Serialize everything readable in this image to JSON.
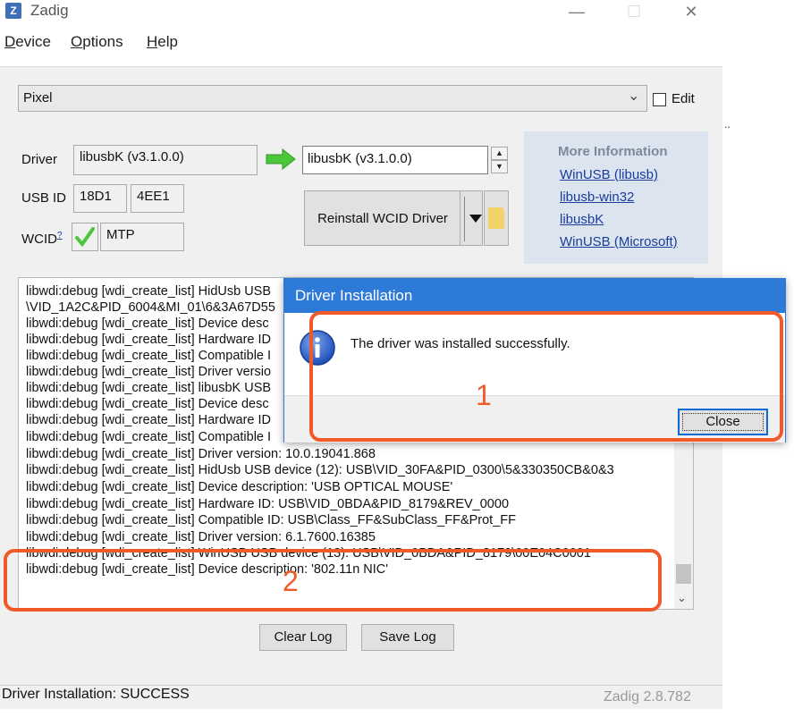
{
  "window": {
    "title": "Zadig",
    "icon_letter": "Z",
    "controls": {
      "minimize": "—",
      "maximize": "☐",
      "close": "✕"
    }
  },
  "menu": [
    "Device",
    "Options",
    "Help"
  ],
  "device_select": {
    "value": "Pixel",
    "edit_label": "Edit",
    "edit_checked": false
  },
  "driver": {
    "label": "Driver",
    "current": "libusbK (v3.1.0.0)",
    "target": "libusbK (v3.1.0.0)",
    "usb_id_label": "USB ID",
    "vid": "18D1",
    "pid": "4EE1",
    "wcid_label": "WCID",
    "wcid_superscript": "?",
    "wcid_value": "MTP",
    "action_button": "Reinstall WCID Driver"
  },
  "more_info": {
    "title": "More Information",
    "links": [
      "WinUSB (libusb)",
      "libusb-win32",
      "libusbK",
      "WinUSB (Microsoft)"
    ]
  },
  "log": [
    "libwdi:debug [wdi_create_list] HidUsb USB",
    "\\VID_1A2C&PID_6004&MI_01\\6&3A67D55",
    "libwdi:debug [wdi_create_list] Device desc",
    "libwdi:debug [wdi_create_list] Hardware ID",
    "libwdi:debug [wdi_create_list] Compatible I",
    "libwdi:debug [wdi_create_list] Driver versio",
    "libwdi:debug [wdi_create_list] libusbK USB",
    "libwdi:debug [wdi_create_list] Device desc",
    "libwdi:debug [wdi_create_list] Hardware ID",
    "libwdi:debug [wdi_create_list] Compatible I",
    "libwdi:debug [wdi_create_list] Driver version: 10.0.19041.868",
    "libwdi:debug [wdi_create_list] HidUsb USB device (12): USB\\VID_30FA&PID_0300\\5&330350CB&0&3",
    "libwdi:debug [wdi_create_list] Device description: 'USB OPTICAL MOUSE'",
    "libwdi:debug [wdi_create_list] Hardware ID: USB\\VID_0BDA&PID_8179&REV_0000",
    "libwdi:debug [wdi_create_list] Compatible ID: USB\\Class_FF&SubClass_FF&Prot_FF",
    "libwdi:debug [wdi_create_list] Driver version: 6.1.7600.16385",
    "libwdi:debug [wdi_create_list] WinUSB USB device (13): USB\\VID_0BDA&PID_8179\\00E04C0001",
    "libwdi:debug [wdi_create_list] Device description: '802.11n NIC'"
  ],
  "buttons": {
    "clear_log": "Clear Log",
    "save_log": "Save Log"
  },
  "status": {
    "text": "Driver Installation: SUCCESS",
    "version": "Zadig 2.8.782"
  },
  "dialog": {
    "title": "Driver Installation",
    "message": "The driver was installed successfully.",
    "close_label": "Close"
  },
  "annotations": [
    {
      "number": "1",
      "color": "#f05a28"
    },
    {
      "number": "2",
      "color": "#f05a28"
    }
  ],
  "colors": {
    "dialog_title_bar": "#2e7ad8",
    "annotation": "#f05a28",
    "link": "#1a3c9b",
    "more_info_bg": "#dbe4ef"
  },
  "right_strip_text": ".."
}
